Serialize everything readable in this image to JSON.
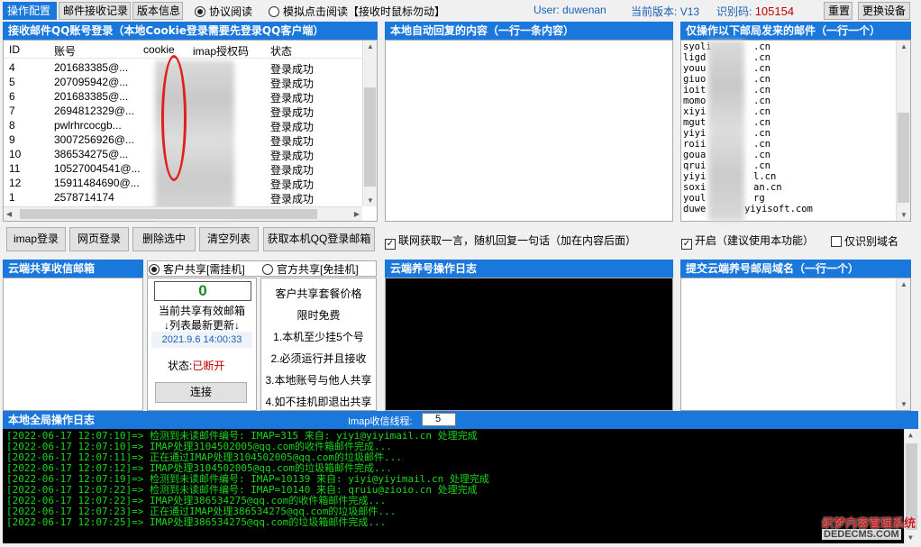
{
  "tabs": [
    {
      "label": "操作配置",
      "active": true
    },
    {
      "label": "邮件接收记录",
      "active": false
    },
    {
      "label": "版本信息",
      "active": false
    }
  ],
  "read_mode": {
    "protocol_label": "协议阅读",
    "simulate_label": "模拟点击阅读【接收时鼠标勿动】",
    "selected": "protocol"
  },
  "status_bar": {
    "user_label": "User:",
    "user_value": "duwenan",
    "version_label": "当前版本:",
    "version_value": "V13",
    "idcode_label": "识别码:",
    "idcode_value": "105154",
    "reset_label": "重置",
    "change_device_label": "更换设备"
  },
  "accounts_panel": {
    "title": "接收邮件QQ账号登录（本地Cookie登录需要先登录QQ客户端）",
    "columns": [
      "ID",
      "账号",
      "cookie",
      "imap授权码",
      "状态"
    ],
    "rows": [
      {
        "id": "4",
        "account": "201683385@...",
        "status": "登录成功"
      },
      {
        "id": "5",
        "account": "207095942@...",
        "status": "登录成功"
      },
      {
        "id": "6",
        "account": "201683385@...",
        "status": "登录成功"
      },
      {
        "id": "7",
        "account": "2694812329@...",
        "status": "登录成功"
      },
      {
        "id": "8",
        "account": "pwlrhrcocgb...",
        "status": "登录成功"
      },
      {
        "id": "9",
        "account": "3007256926@...",
        "status": "登录成功"
      },
      {
        "id": "10",
        "account": "386534275@...",
        "status": "登录成功"
      },
      {
        "id": "11",
        "account": "10527004541@...",
        "status": "登录成功"
      },
      {
        "id": "12",
        "account": "15911484690@...",
        "status": "登录成功"
      },
      {
        "id": "1",
        "account": "2578714174",
        "status": "登录成功"
      }
    ],
    "buttons": [
      "imap登录",
      "网页登录",
      "删除选中",
      "清空列表",
      "获取本机QQ登录邮箱"
    ]
  },
  "auto_reply_panel": {
    "title": "本地自动回复的内容（一行一条内容）",
    "checkbox_label": "联网获取一言，随机回复一句话（加在内容后面）",
    "checked": true
  },
  "domains_panel": {
    "title": "仅操作以下邮局发来的邮件（一行一个）",
    "lines": [
      "syoli",
      "ligd",
      "youu",
      "giuo",
      "ioit",
      "momo",
      "xiyi",
      "mgut",
      "yiyi",
      "roii",
      "goua",
      "qrui",
      "yiyi",
      "soxi",
      "youl",
      "duwe"
    ],
    "line_suffixes": [
      ".cn",
      ".cn",
      ".cn",
      ".cn",
      ".cn",
      ".cn",
      ".cn",
      ".cn",
      ".cn",
      ".cn",
      ".cn",
      ".cn",
      "l.cn",
      "an.cn",
      "rg",
      "yiyisoft.com"
    ],
    "enable_label": "开启（建议使用本功能）",
    "enable_checked": true,
    "only_identify_label": "仅识别域名",
    "only_identify_checked": false
  },
  "cloud_mailbox_panel": {
    "title": "云端共享收信邮箱",
    "share_client_label": "客户共享[需挂机]",
    "share_official_label": "官方共享[免挂机]",
    "selected": "client",
    "count": "0",
    "count_caption": "当前共享有效邮箱",
    "refresh_caption": "↓列表最新更新↓",
    "updated_time": "2021.9.6 14:00:33",
    "status_label": "状态:",
    "status_value": "已断开",
    "connect_label": "连接",
    "price_lines": [
      "客户共享套餐价格",
      "限时免费",
      "1.本机至少挂5个号",
      "2.必须运行并且接收",
      "3.本地账号与他人共享",
      "4.如不挂机即退出共享"
    ]
  },
  "cloud_log_panel": {
    "title": "云端养号操作日志"
  },
  "submit_domain_panel": {
    "title": "提交云端养号邮局域名（一行一个）"
  },
  "global_log": {
    "title": "本地全局操作日志",
    "threads_label": "Imap收信线程:",
    "threads_value": "5",
    "lines": [
      "[2022-06-17 12:07:10]=> 检测到未读邮件编号: IMAP=315 来自: yiyi@yiyimail.cn 处理完成",
      "[2022-06-17 12:07:10]=> IMAP处理3104502005@qq.com的收件箱邮件完成...",
      "[2022-06-17 12:07:11]=> 正在通过IMAP处理3104502005@qq.com的垃圾邮件...",
      "[2022-06-17 12:07:12]=> IMAP处理3104502005@qq.com的垃圾箱邮件完成...",
      "[2022-06-17 12:07:19]=> 检测到未读邮件编号: IMAP=10139 来自: yiyi@yiyimail.cn 处理完成",
      "[2022-06-17 12:07:22]=> 检测到未读邮件编号: IMAP=10140 来自: qruiu@zioio.cn 处理完成",
      "[2022-06-17 12:07:22]=> IMAP处理386534275@qq.com的收件箱邮件完成...",
      "[2022-06-17 12:07:23]=> 正在通过IMAP处理386534275@qq.com的垃圾邮件...",
      "[2022-06-17 12:07:25]=> IMAP处理386534275@qq.com的垃圾箱邮件完成..."
    ]
  },
  "watermark": {
    "line1": "织梦内容管理系统",
    "line2": "DEDECMS.COM"
  },
  "colors": {
    "accent": "#1a78dc",
    "log_text": "#1ad81a",
    "status_red": "#c00000",
    "count_green": "#1a8a1a",
    "time_blue": "#1a5fb4"
  }
}
